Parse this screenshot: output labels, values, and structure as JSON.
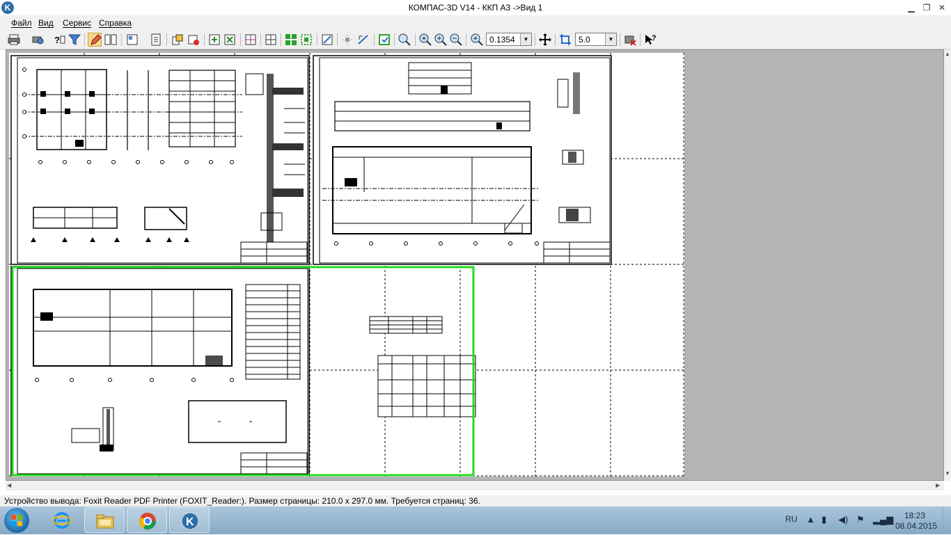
{
  "window": {
    "title": "КОМПАС-3D V14 - ККП А3 ->Вид 1",
    "app_icon_letter": "K",
    "controls": {
      "minimize": "▁",
      "restore": "❐",
      "close": "✕"
    }
  },
  "menu": {
    "items": [
      {
        "label": "Файл"
      },
      {
        "label": "Вид"
      },
      {
        "label": "Сервис"
      },
      {
        "label": "Справка"
      }
    ]
  },
  "toolbar": {
    "zoom_value": "0.1354",
    "step_value": "5.0",
    "icons": [
      "print-icon",
      "print-setup-icon",
      "help-cursor-icon",
      "filter-icon",
      "pencil-icon",
      "layout-icon",
      "sheet-icon",
      "page-icon",
      "rotate-icon",
      "cut-icon",
      "fit-icon",
      "fit2-icon",
      "grid-icon",
      "grid-green-icon",
      "grid-green2-icon",
      "snap-icon",
      "move-icon",
      "align-icon",
      "select-icon",
      "zoom-icon",
      "zoom-in-icon",
      "zoom-out-icon",
      "zoom-fit-icon",
      "pan-icon",
      "cursor-icon",
      "close-print-icon",
      "help-icon"
    ]
  },
  "drawing": {
    "sheets": [
      {
        "name": "sheet-top-left"
      },
      {
        "name": "sheet-top-right"
      },
      {
        "name": "sheet-bottom-left"
      }
    ],
    "accent_color": "#22dd22"
  },
  "status": {
    "text": "Устройство вывода: Foxit Reader PDF Printer (FOXIT_Reader:). Размер страницы: 210.0 x 297.0 мм. Требуется страниц: 36."
  },
  "taskbar": {
    "language": "RU",
    "time": "18:23",
    "date": "08.04.2015",
    "apps": [
      "explorer",
      "chrome",
      "kompas"
    ]
  }
}
